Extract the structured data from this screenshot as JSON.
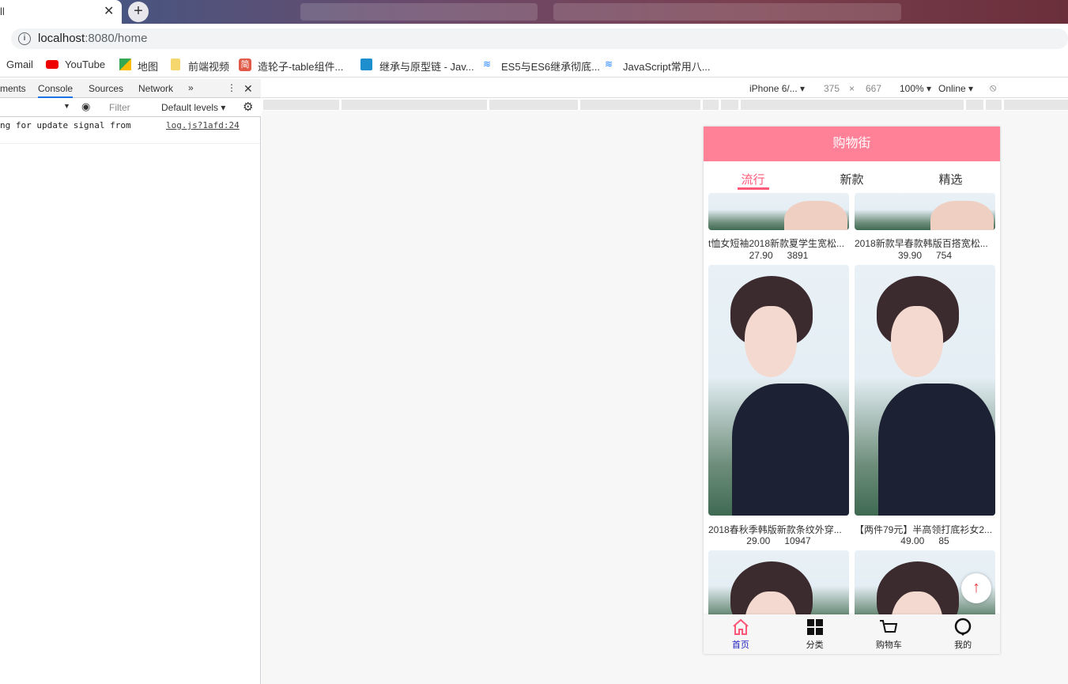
{
  "browser": {
    "tab_title": "ll",
    "tab_close": "✕",
    "new_tab": "+",
    "url_host": "localhost",
    "url_path": ":8080/home",
    "bookmarks": [
      {
        "label": "Gmail",
        "icon": "gmail-icon"
      },
      {
        "label": "YouTube",
        "icon": "youtube-icon"
      },
      {
        "label": "地图",
        "icon": "maps-icon"
      },
      {
        "label": "前端视频",
        "icon": "folder-icon"
      },
      {
        "label": "造轮子-table组件...",
        "icon": "jian-icon"
      },
      {
        "label": "继承与原型链 - Jav...",
        "icon": "mdn-icon"
      },
      {
        "label": "ES5与ES6继承彻底...",
        "icon": "juejin-icon"
      },
      {
        "label": "JavaScript常用八...",
        "icon": "juejin-icon"
      }
    ]
  },
  "devtools": {
    "tabs": [
      "ments",
      "Console",
      "Sources",
      "Network",
      "»"
    ],
    "active_tab": "Console",
    "filter_placeholder": "Filter",
    "levels": "Default levels",
    "log_text": "ng for update signal from",
    "log_link": "log.js?1afd:24"
  },
  "device_toolbar": {
    "device": "iPhone 6/...",
    "width": "375",
    "times": "×",
    "height": "667",
    "zoom": "100%",
    "network": "Online"
  },
  "app": {
    "nav_title": "购物街",
    "tabs": [
      "流行",
      "新款",
      "精选"
    ],
    "active_tab_index": 0,
    "goods": [
      {
        "title": "t恤女短袖2018新款夏学生宽松...",
        "price": "27.90",
        "cfav": "3891"
      },
      {
        "title": "2018新款早春款韩版百搭宽松...",
        "price": "39.90",
        "cfav": "754"
      },
      {
        "title": "2018春秋季韩版新款条纹外穿...",
        "price": "29.00",
        "cfav": "10947"
      },
      {
        "title": "【两件79元】半高领打底衫女2...",
        "price": "49.00",
        "cfav": "85"
      },
      {
        "title": "",
        "price": "",
        "cfav": ""
      },
      {
        "title": "",
        "price": "",
        "cfav": ""
      }
    ],
    "back_top": "↑",
    "tabbar": [
      {
        "label": "首页",
        "icon": "home-icon"
      },
      {
        "label": "分类",
        "icon": "category-icon"
      },
      {
        "label": "购物车",
        "icon": "cart-icon"
      },
      {
        "label": "我的",
        "icon": "profile-icon"
      }
    ],
    "colors": {
      "nav": "#ff8198",
      "active": "#ff5777",
      "tabbar_active": "#1d1dbf"
    }
  }
}
